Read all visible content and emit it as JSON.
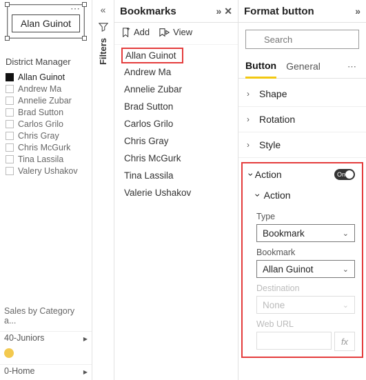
{
  "canvas": {
    "button_label": "Alan Guinot",
    "slicer_title": "District Manager",
    "slicer_items": [
      {
        "label": "Allan Guinot",
        "selected": true
      },
      {
        "label": "Andrew Ma",
        "selected": false
      },
      {
        "label": "Annelie Zubar",
        "selected": false
      },
      {
        "label": "Brad Sutton",
        "selected": false
      },
      {
        "label": "Carlos Grilo",
        "selected": false
      },
      {
        "label": "Chris Gray",
        "selected": false
      },
      {
        "label": "Chris McGurk",
        "selected": false
      },
      {
        "label": "Tina Lassila",
        "selected": false
      },
      {
        "label": "Valery Ushakov",
        "selected": false
      }
    ],
    "sales_label": "Sales by Category a...",
    "page_juniors": "40-Juniors",
    "page_home": "0-Home"
  },
  "filters": {
    "label": "Filters"
  },
  "bookmarks": {
    "title": "Bookmarks",
    "add_label": "Add",
    "view_label": "View",
    "items": [
      "Allan Guinot",
      "Andrew Ma",
      "Annelie Zubar",
      "Brad Sutton",
      "Carlos Grilo",
      "Chris Gray",
      "Chris McGurk",
      "Tina Lassila",
      "Valerie Ushakov"
    ]
  },
  "format": {
    "title": "Format button",
    "search_placeholder": "Search",
    "tabs": {
      "button": "Button",
      "general": "General"
    },
    "sections": {
      "shape": "Shape",
      "rotation": "Rotation",
      "style": "Style"
    },
    "action": {
      "label": "Action",
      "toggle_text": "On",
      "sub_label": "Action",
      "type_label": "Type",
      "type_value": "Bookmark",
      "bookmark_label": "Bookmark",
      "bookmark_value": "Allan Guinot",
      "destination_label": "Destination",
      "destination_value": "None",
      "weburl_label": "Web URL",
      "fx": "fx"
    }
  }
}
